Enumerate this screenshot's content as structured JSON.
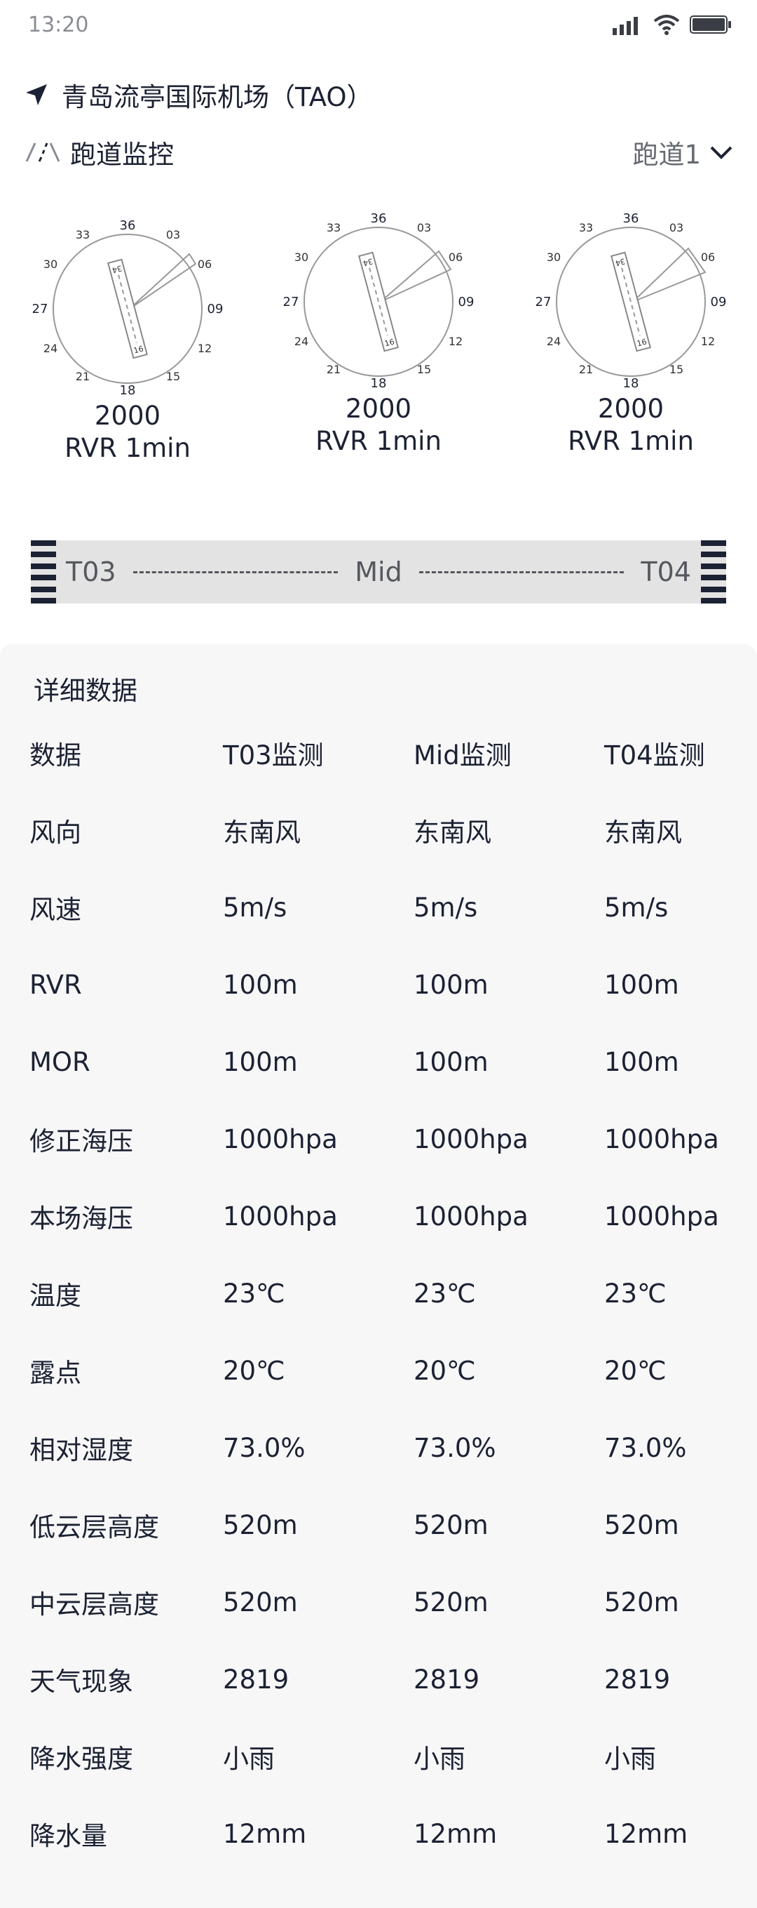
{
  "status_bar": {
    "time": "13:20"
  },
  "header": {
    "airport": "青岛流亭国际机场（TAO）"
  },
  "runway_monitor": {
    "title": "跑道监控",
    "selected_runway": "跑道1"
  },
  "dials": [
    {
      "value": "2000",
      "label": "RVR 1min"
    },
    {
      "value": "2000",
      "label": "RVR 1min"
    },
    {
      "value": "2000",
      "label": "RVR 1min"
    }
  ],
  "dial_ticks": {
    "north": "36",
    "n03": "03",
    "n06": "06",
    "east": "09",
    "n12": "12",
    "n15": "15",
    "south": "18",
    "n21": "21",
    "n24": "24",
    "west": "27",
    "n30": "30",
    "n33": "33",
    "runway_top": "34",
    "runway_bottom": "16"
  },
  "runway_bar": {
    "left": "T03",
    "mid": "Mid",
    "right": "T04"
  },
  "detail": {
    "title": "详细数据",
    "header": [
      "数据",
      "T03监测",
      "Mid监测",
      "T04监测"
    ],
    "rows": [
      [
        "风向",
        "东南风",
        "东南风",
        "东南风"
      ],
      [
        "风速",
        "5m/s",
        "5m/s",
        "5m/s"
      ],
      [
        "RVR",
        "100m",
        "100m",
        "100m"
      ],
      [
        "MOR",
        "100m",
        "100m",
        "100m"
      ],
      [
        "修正海压",
        "1000hpa",
        "1000hpa",
        "1000hpa"
      ],
      [
        "本场海压",
        "1000hpa",
        "1000hpa",
        "1000hpa"
      ],
      [
        "温度",
        "23℃",
        "23℃",
        "23℃"
      ],
      [
        "露点",
        "20℃",
        "20℃",
        "20℃"
      ],
      [
        "相对湿度",
        "73.0%",
        "73.0%",
        "73.0%"
      ],
      [
        "低云层高度",
        "520m",
        "520m",
        "520m"
      ],
      [
        "中云层高度",
        "520m",
        "520m",
        "520m"
      ],
      [
        "天气现象",
        "2819",
        "2819",
        "2819"
      ],
      [
        "降水强度",
        "小雨",
        "小雨",
        "小雨"
      ],
      [
        "降水量",
        "12mm",
        "12mm",
        "12mm"
      ]
    ]
  },
  "icons": {
    "location": "location-arrow-icon",
    "runway": "runway-icon",
    "dropdown": "chevron-down-icon",
    "signal": "signal-icon",
    "wifi": "wifi-icon",
    "battery": "battery-icon"
  },
  "colors": {
    "primary": "#1c2233",
    "muted": "#8a8d93",
    "bar": "#e3e3e3",
    "panel": "#f7f7f8"
  }
}
